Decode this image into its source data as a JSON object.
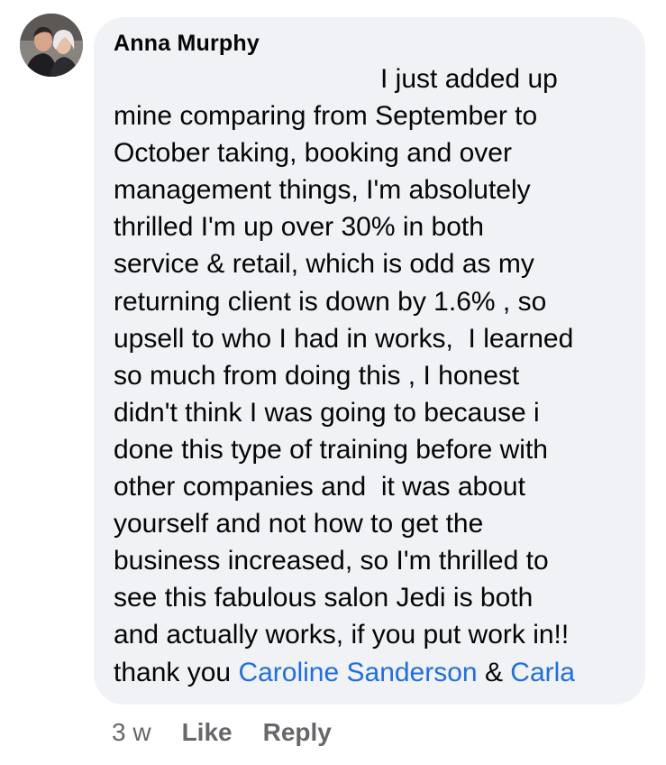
{
  "comment": {
    "author": "Anna Murphy",
    "lines": [
      "I just added up",
      "mine comparing from September to",
      "October taking, booking and over",
      "management things, I'm absolutely",
      "thrilled I'm up over 30% in both",
      "service & retail, which is odd as my",
      "returning client is down by 1.6% , so",
      "upsell to who I had in works,  I learned",
      "so much from doing this , I honest",
      "didn't think I was going to because i",
      "done this type of training before with",
      "other companies and  it was about",
      "yourself and not how to get the",
      "business increased, so I'm thrilled to",
      "see this fabulous salon Jedi is both",
      "and actually works, if you put work in!!"
    ],
    "last_line": {
      "prefix": "thank you ",
      "mention1": "Caroline Sanderson",
      "separator": " & ",
      "mention2": "Carla"
    }
  },
  "actions": {
    "time": "3 w",
    "like": "Like",
    "reply": "Reply"
  },
  "colors": {
    "bubble": "#f0f2f5",
    "mention": "#216fdb",
    "meta": "#65676b"
  },
  "icons": {
    "avatar": "profile-photo-couple"
  }
}
